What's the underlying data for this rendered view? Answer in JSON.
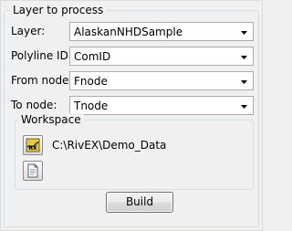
{
  "layer_group": {
    "title": "Layer to process",
    "layer_label": "Layer:",
    "layer_value": "AlaskanNHDSample",
    "polyline_label": "Polyline ID:",
    "polyline_value": "ComID",
    "from_label": "From node:",
    "from_value": "Fnode",
    "to_label": "To node:",
    "to_value": "Tnode"
  },
  "workspace": {
    "title": "Workspace",
    "path": "C:\\RivEX\\Demo_Data",
    "browse_icon": "rivex-workspace-icon",
    "open_icon": "document-icon"
  },
  "build_button": "Build"
}
